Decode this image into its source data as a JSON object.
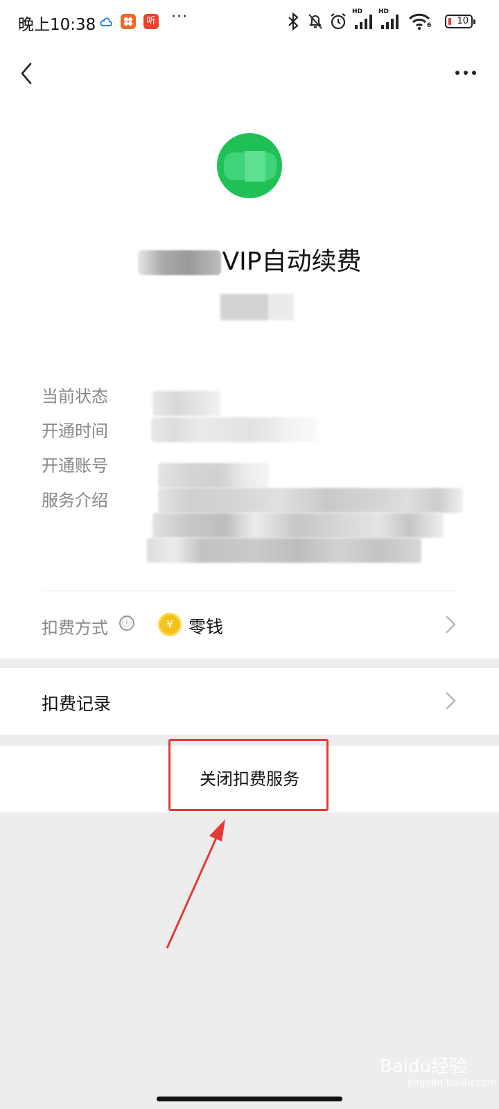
{
  "status_bar": {
    "time": "晚上10:38",
    "app_badge_2": "听",
    "signal_1_label": "HD",
    "signal_2_label": "HD",
    "wifi_label": "6",
    "battery_level": "10"
  },
  "nav": {
    "back_icon": "chevron-left-icon",
    "more_icon": "more-horizontal-icon"
  },
  "header": {
    "title_suffix": "VIP自动续费"
  },
  "info": {
    "labels": [
      "当前状态",
      "开通时间",
      "开通账号",
      "服务介绍"
    ]
  },
  "payment": {
    "label": "扣费方式",
    "info_icon": "ⓘ",
    "coin_icon": "¥",
    "method": "零钱"
  },
  "record": {
    "label": "扣费记录"
  },
  "actions": {
    "close_service": "关闭扣费服务"
  },
  "watermark": {
    "text": "Baidu经验",
    "sub": "jingyan.baidu.com"
  },
  "colors": {
    "accent_green": "#1fc055",
    "annotation_red": "#e53935",
    "background_gray": "#ededed"
  }
}
